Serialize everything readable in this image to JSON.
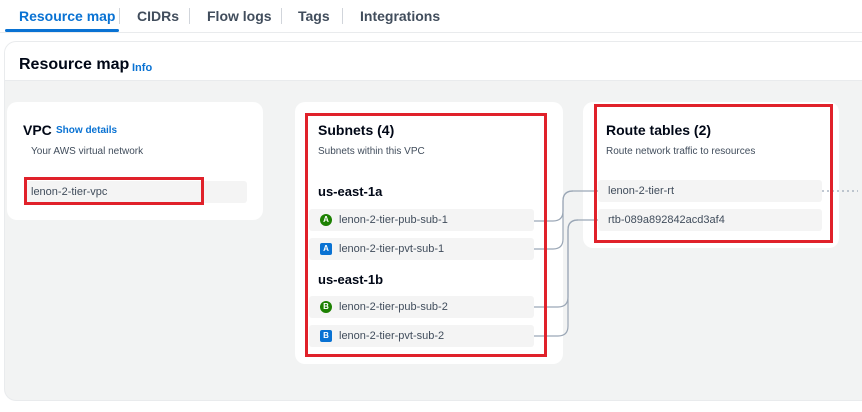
{
  "tabs": [
    {
      "label": "Resource map"
    },
    {
      "label": "CIDRs"
    },
    {
      "label": "Flow logs"
    },
    {
      "label": "Tags"
    },
    {
      "label": "Integrations"
    }
  ],
  "resource_map": {
    "title": "Resource map",
    "info": "Info"
  },
  "vpc": {
    "title": "VPC",
    "show_details": "Show details",
    "subtitle": "Your AWS virtual network",
    "name": "lenon-2-tier-vpc"
  },
  "subnets": {
    "title": "Subnets (4)",
    "subtitle": "Subnets within this VPC",
    "zones": [
      {
        "name": "us-east-1a",
        "items": [
          {
            "badge": "A",
            "label": "lenon-2-tier-pub-sub-1"
          },
          {
            "badge": "A",
            "label": "lenon-2-tier-pvt-sub-1"
          }
        ]
      },
      {
        "name": "us-east-1b",
        "items": [
          {
            "badge": "B",
            "label": "lenon-2-tier-pub-sub-2"
          },
          {
            "badge": "B",
            "label": "lenon-2-tier-pvt-sub-2"
          }
        ]
      }
    ]
  },
  "route_tables": {
    "title": "Route tables (2)",
    "subtitle": "Route network traffic to resources",
    "items": [
      {
        "label": "lenon-2-tier-rt"
      },
      {
        "label": "rtb-089a892842acd3af4"
      }
    ]
  },
  "colors": {
    "accent": "#0972d3",
    "highlight": "#e0212a",
    "public_badge": "#1d8102",
    "private_badge": "#0972d3"
  }
}
